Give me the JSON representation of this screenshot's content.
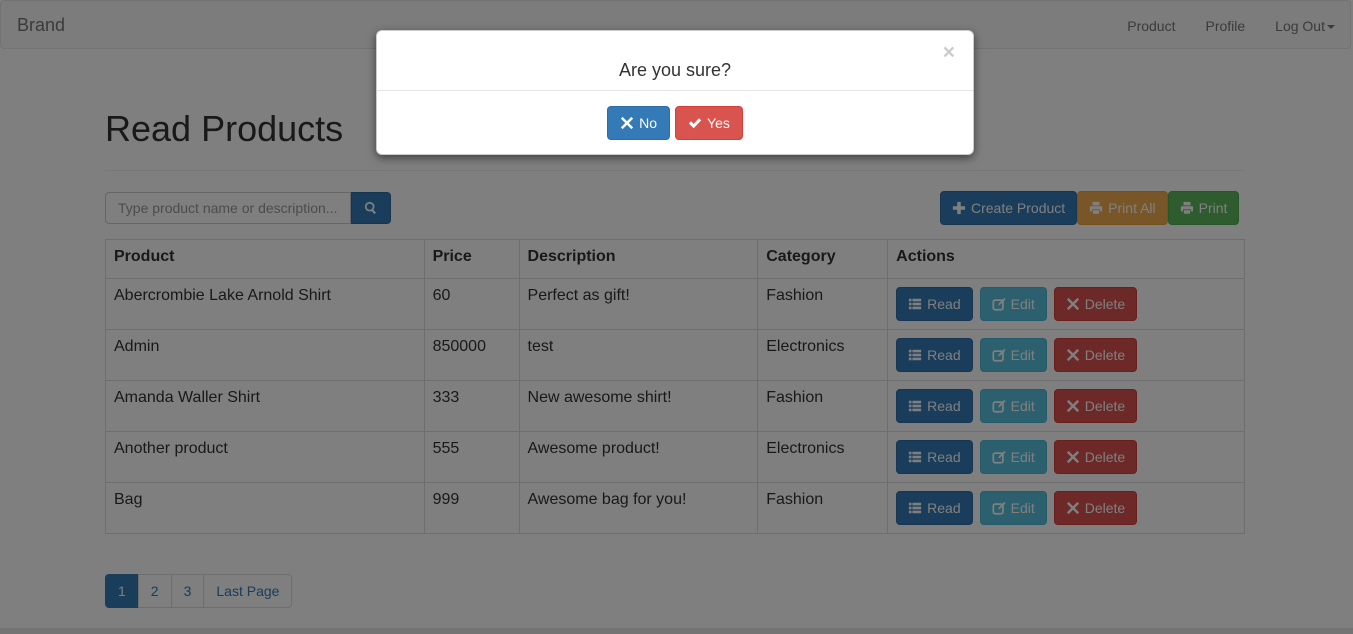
{
  "navbar": {
    "brand": "Brand",
    "links": [
      "Product",
      "Profile",
      "Log Out"
    ]
  },
  "page": {
    "title": "Read Products"
  },
  "search": {
    "placeholder": "Type product name or description..."
  },
  "toolbar": {
    "create_label": "Create Product",
    "print_all_label": "Print All",
    "print_label": "Print"
  },
  "table": {
    "headers": [
      "Product",
      "Price",
      "Description",
      "Category",
      "Actions"
    ],
    "rows": [
      {
        "product": "Abercrombie Lake Arnold Shirt",
        "price": "60",
        "description": "Perfect as gift!",
        "category": "Fashion"
      },
      {
        "product": "Admin",
        "price": "850000",
        "description": "test",
        "category": "Electronics"
      },
      {
        "product": "Amanda Waller Shirt",
        "price": "333",
        "description": "New awesome shirt!",
        "category": "Fashion"
      },
      {
        "product": "Another product",
        "price": "555",
        "description": "Awesome product!",
        "category": "Electronics"
      },
      {
        "product": "Bag",
        "price": "999",
        "description": "Awesome bag for you!",
        "category": "Fashion"
      }
    ],
    "action_labels": {
      "read": "Read",
      "edit": "Edit",
      "delete": "Delete"
    }
  },
  "pagination": {
    "pages": [
      "1",
      "2",
      "3"
    ],
    "last_label": "Last Page",
    "active_page": "1"
  },
  "modal": {
    "title": "Are you sure?",
    "close_symbol": "×",
    "no_label": "No",
    "yes_label": "Yes"
  },
  "colors": {
    "primary": "#337ab7",
    "warning": "#f0ad4e",
    "success": "#5cb85c",
    "info": "#5bc0de",
    "danger": "#d9534f"
  },
  "icons": {
    "search": "search-icon",
    "create": "plus-icon",
    "print": "print-icon",
    "read": "list-icon",
    "edit": "edit-icon",
    "delete": "remove-icon",
    "no": "remove-icon",
    "yes": "check-icon",
    "logout": "caret-down-icon"
  }
}
